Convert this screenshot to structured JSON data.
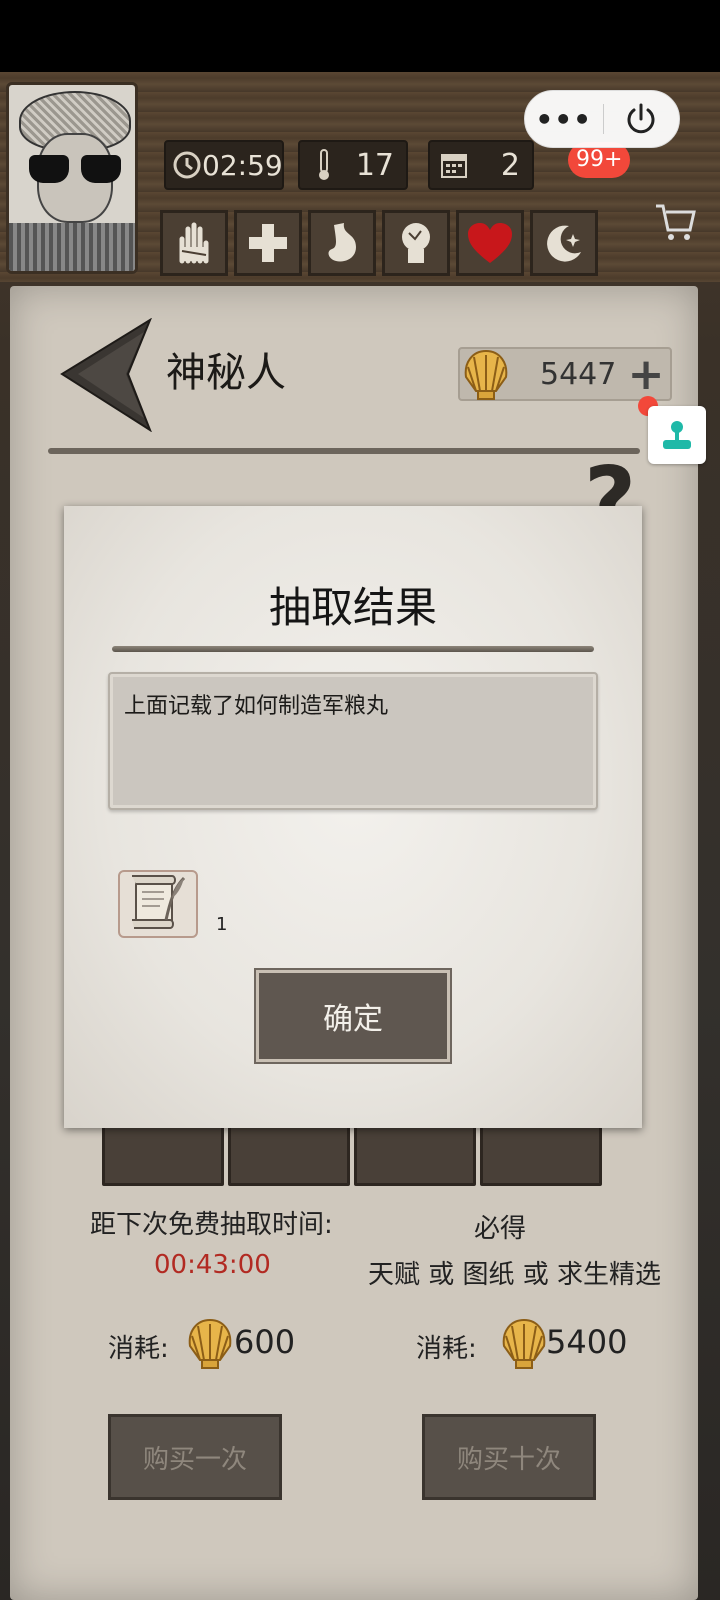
{
  "status_icons": {
    "clock_icon": "clock-icon",
    "thermometer_icon": "thermometer-icon",
    "calendar_icon": "calendar-icon"
  },
  "stats": {
    "time": "02:59",
    "temperature": "17",
    "day": "2"
  },
  "condition_icons": [
    "hand-icon",
    "plus-icon",
    "stomach-icon",
    "head-icon",
    "heart-icon",
    "moon-icon"
  ],
  "miniapp": {
    "badge": "99+",
    "more_icon": "more-icon",
    "power_icon": "power-icon"
  },
  "shop": {
    "title": "神秘人",
    "shells": "5447",
    "help_icon": "help-icon"
  },
  "modal": {
    "title": "抽取结果",
    "description": "上面记载了如何制造军粮丸",
    "item_count": "1",
    "confirm_label": "确定"
  },
  "draw": {
    "free_label": "距下次免费抽取时间:",
    "free_timer": "00:43:00",
    "guarantee_label": "必得",
    "guarantee_options": "天赋 或 图纸 或 求生精选",
    "cost_label": "消耗:",
    "cost_single": "600",
    "cost_ten": "5400",
    "buy_once_label": "购买一次",
    "buy_ten_label": "购买十次"
  },
  "colors": {
    "timer_red": "#b22a22",
    "badge_red": "#f2483a",
    "heart_red": "#c8171b",
    "float_teal": "#1fb9a8"
  }
}
